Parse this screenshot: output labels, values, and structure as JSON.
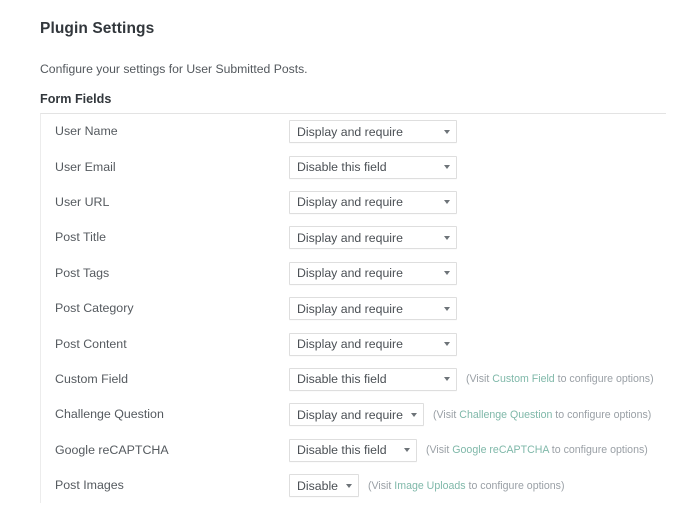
{
  "header": {
    "title": "Plugin Settings",
    "subtitle": "Configure your settings for User Submitted Posts.",
    "section_title": "Form Fields"
  },
  "colors": {
    "text": "#555a5f",
    "heading": "#32373c",
    "hint": "#9aa0a6",
    "link": "#7fb8a9",
    "border": "#dedede"
  },
  "form_fields": [
    {
      "label": "User Name",
      "value": "Display and require",
      "width": "w-wide",
      "hint": null
    },
    {
      "label": "User Email",
      "value": "Disable this field",
      "width": "w-wide",
      "hint": null
    },
    {
      "label": "User URL",
      "value": "Display and require",
      "width": "w-wide",
      "hint": null
    },
    {
      "label": "Post Title",
      "value": "Display and require",
      "width": "w-wide",
      "hint": null
    },
    {
      "label": "Post Tags",
      "value": "Display and require",
      "width": "w-wide",
      "hint": null
    },
    {
      "label": "Post Category",
      "value": "Display and require",
      "width": "w-wide",
      "hint": null
    },
    {
      "label": "Post Content",
      "value": "Display and require",
      "width": "w-wide",
      "hint": null
    },
    {
      "label": "Custom Field",
      "value": "Disable this field",
      "width": "w-wide",
      "hint": {
        "prefix": "(Visit ",
        "link": "Custom Field",
        "suffix": " to configure options)"
      }
    },
    {
      "label": "Challenge Question",
      "value": "Display and require",
      "width": "w-mid",
      "hint": {
        "prefix": "(Visit ",
        "link": "Challenge Question",
        "suffix": " to configure options)"
      }
    },
    {
      "label": "Google reCAPTCHA",
      "value": "Disable this field",
      "width": "w-mid2",
      "hint": {
        "prefix": "(Visit ",
        "link": "Google reCAPTCHA",
        "suffix": " to configure options)"
      }
    },
    {
      "label": "Post Images",
      "value": "Disable",
      "width": "w-narrow",
      "hint": {
        "prefix": "(Visit ",
        "link": "Image Uploads",
        "suffix": " to configure options)"
      }
    }
  ]
}
